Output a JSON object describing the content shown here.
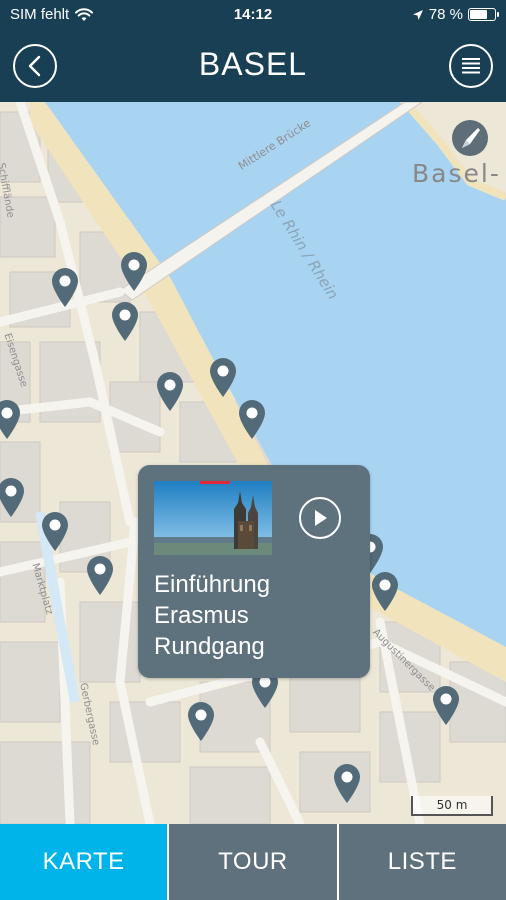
{
  "status_bar": {
    "carrier": "SIM fehlt",
    "time": "14:12",
    "battery_percent": "78 %",
    "battery_level": 0.78
  },
  "header": {
    "title": "BASEL",
    "back_icon": "chevron-left-icon",
    "menu_icon": "menu-list-icon"
  },
  "map": {
    "labels": {
      "bridge": "Mittlere Brücke",
      "river": "Le Rhin / Rhein",
      "town": "Basel-",
      "market": "Marktplatz",
      "street_a": "Gerbergasse",
      "street_b": "Augustinergasse",
      "street_c": "Eisengasse",
      "street_d": "Schifflände"
    },
    "scale_label": "50 m",
    "pin_count": 17
  },
  "popup": {
    "title_lines": [
      "Einführung",
      "Erasmus",
      "Rundgang"
    ],
    "play_icon": "play-icon"
  },
  "tabs": [
    {
      "label": "KARTE",
      "active": true
    },
    {
      "label": "TOUR",
      "active": false
    },
    {
      "label": "LISTE",
      "active": false
    }
  ],
  "colors": {
    "header": "#183f53",
    "tab": "#5e717d",
    "tab_active": "#00b4ea",
    "water": "#a8d3f1",
    "pin": "#536a78"
  }
}
